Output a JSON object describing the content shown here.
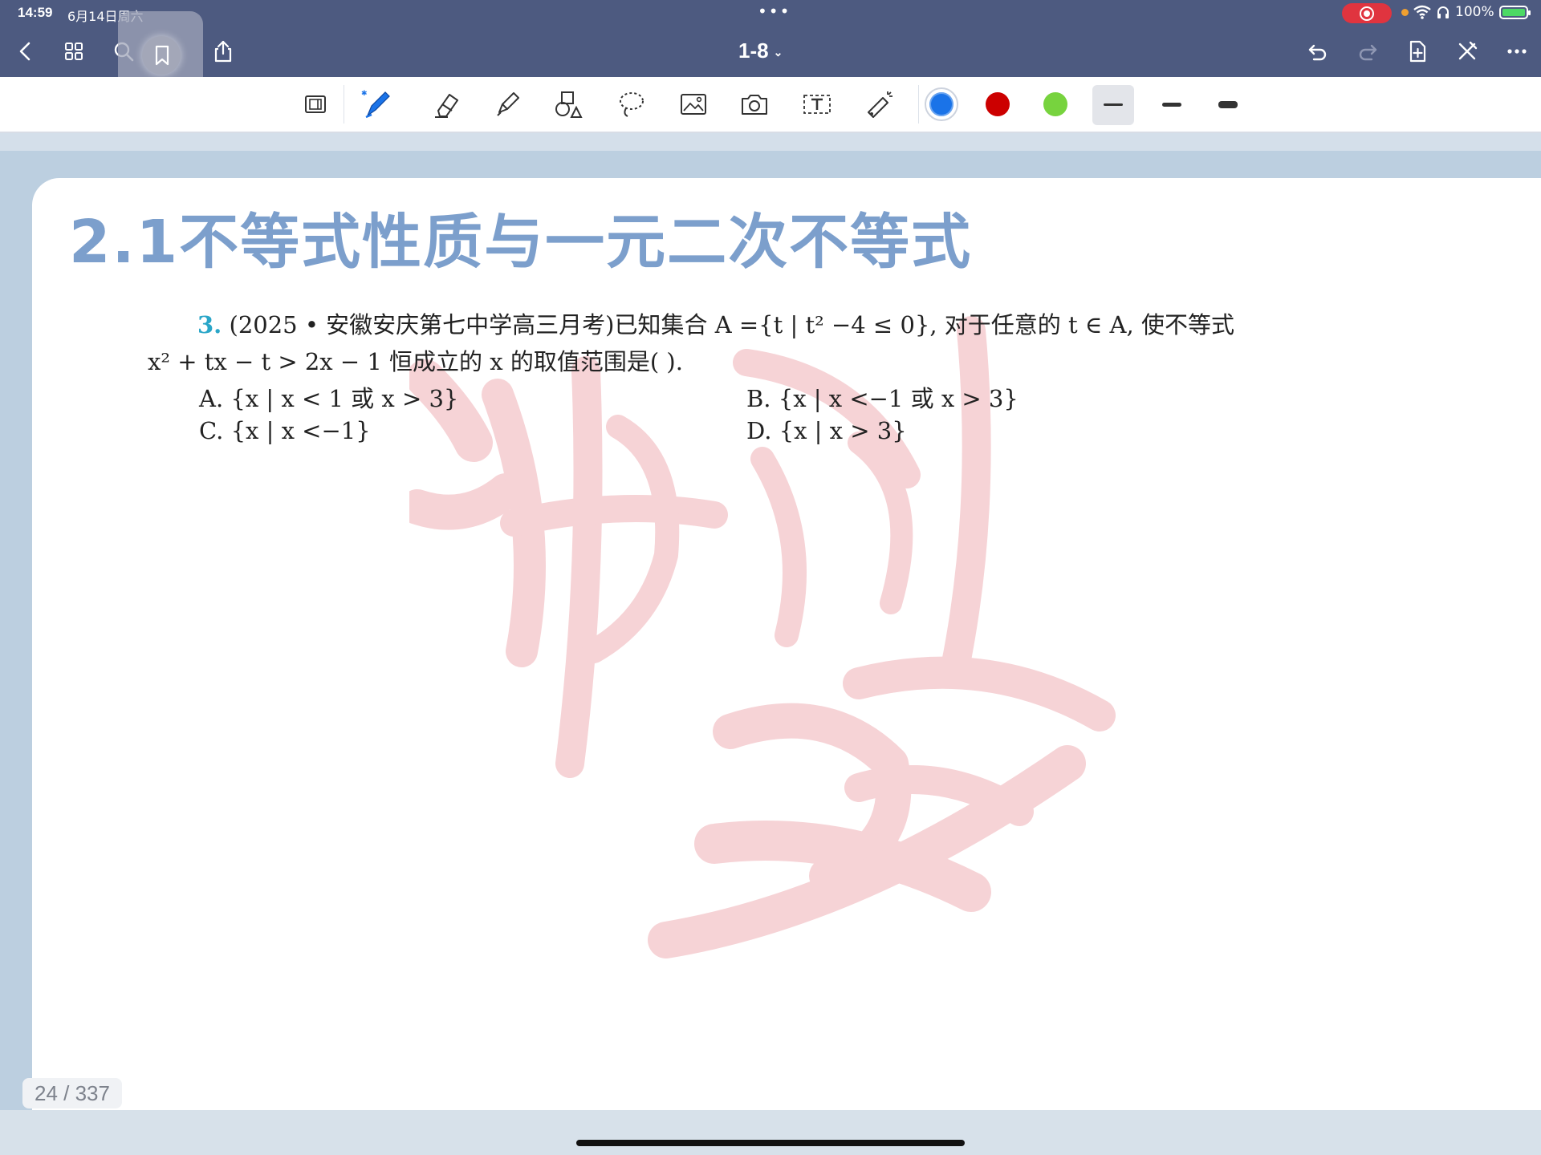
{
  "status_bar": {
    "time": "14:59",
    "date": "6月14日周六",
    "center_dots": "•••",
    "battery_percent": "100%",
    "icons": [
      "screen-record-icon",
      "wifi-icon",
      "headphones-icon",
      "battery-charging-icon"
    ]
  },
  "nav": {
    "title": "1-8",
    "left_icons": [
      "back-icon",
      "grid-icon",
      "search-icon",
      "bookmark-icon",
      "share-icon"
    ],
    "right_icons": [
      "undo-icon",
      "redo-icon",
      "add-page-icon",
      "close-edit-icon",
      "more-icon"
    ]
  },
  "toolbar": {
    "tools": [
      "page-layout-icon",
      "pen-icon",
      "eraser-icon",
      "highlighter-icon",
      "shapes-icon",
      "lasso-icon",
      "image-icon",
      "camera-icon",
      "text-box-icon",
      "laser-pointer-icon"
    ],
    "colors": [
      "#1a73e8",
      "#cc0000",
      "#77d33e"
    ],
    "selected_color": "#1a73e8",
    "stroke_widths": [
      "thin",
      "medium",
      "thick"
    ],
    "selected_stroke": "thin"
  },
  "page": {
    "heading": "2.1不等式性质与一元二次不等式",
    "question": {
      "number": "3.",
      "line1": "(2025 • 安徽安庆第七中学高三月考)已知集合 A ={t | t² −4 ≤ 0}, 对于任意的 t ∈ A, 使不等式",
      "line2": "x² + tx − t > 2x − 1 恒成立的 x 的取值范围是(        ).",
      "options": [
        {
          "label": "A.",
          "text": "{x | x < 1 或 x > 3}"
        },
        {
          "label": "B.",
          "text": "{x | x <−1 或 x > 3}"
        },
        {
          "label": "C.",
          "text": "{x | x <−1}"
        },
        {
          "label": "D.",
          "text": "{x | x > 3}"
        }
      ]
    },
    "watermark_color": "#f6d3d6"
  },
  "page_indicator": "24 / 337"
}
